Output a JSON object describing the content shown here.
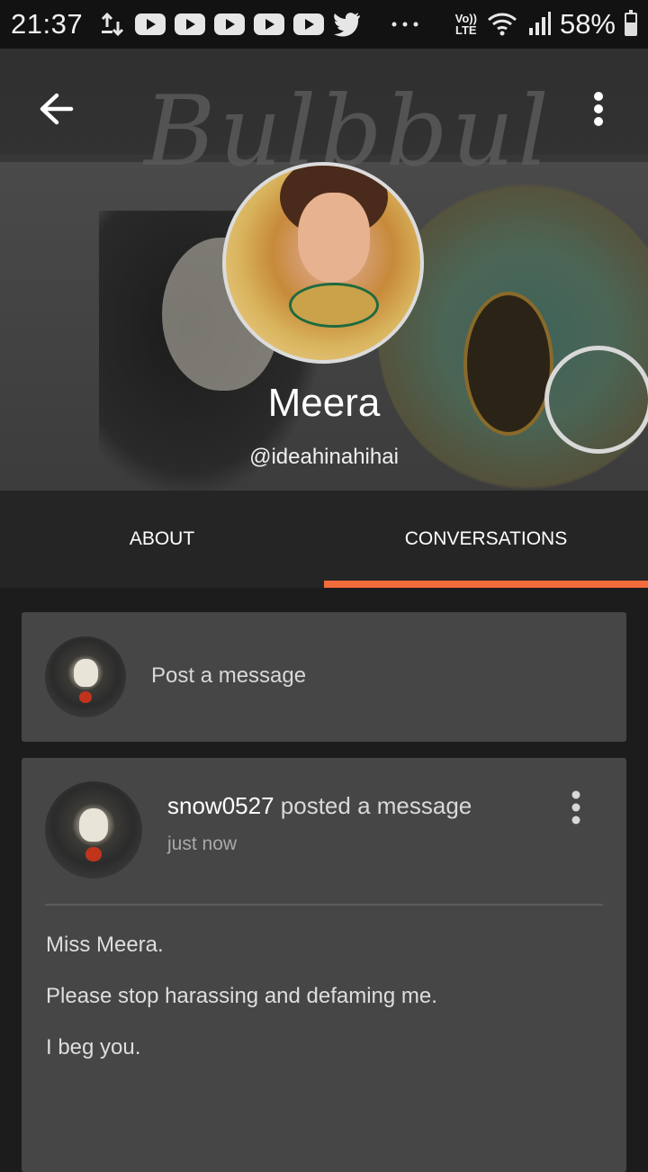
{
  "status_bar": {
    "time": "21:37",
    "network": "VoLTE",
    "network_line1": "Vo))",
    "network_line2": "LTE",
    "battery_percent": "58%",
    "battery_level": 0.58,
    "icons": [
      "download-upload-icon",
      "youtube-icon",
      "youtube-icon",
      "youtube-icon",
      "youtube-icon",
      "youtube-icon",
      "twitter-icon",
      "more-notifications-icon",
      "wifi-icon",
      "signal-icon",
      "battery-icon"
    ]
  },
  "header": {
    "cover_text": "Bulbbul",
    "back_icon": "arrow-left-icon",
    "menu_icon": "more-vertical-icon",
    "profile_name": "Meera",
    "profile_handle": "@ideahinahihai"
  },
  "tabs": [
    {
      "label": "ABOUT",
      "active": false
    },
    {
      "label": "CONVERSATIONS",
      "active": true
    }
  ],
  "accent_color": "#f26b3a",
  "composer": {
    "placeholder": "Post a message"
  },
  "post": {
    "author": "snow0527",
    "action": "posted a message",
    "time": "just now",
    "body": [
      "Miss Meera.",
      "Please stop harassing and defaming me.",
      "I beg you."
    ]
  }
}
